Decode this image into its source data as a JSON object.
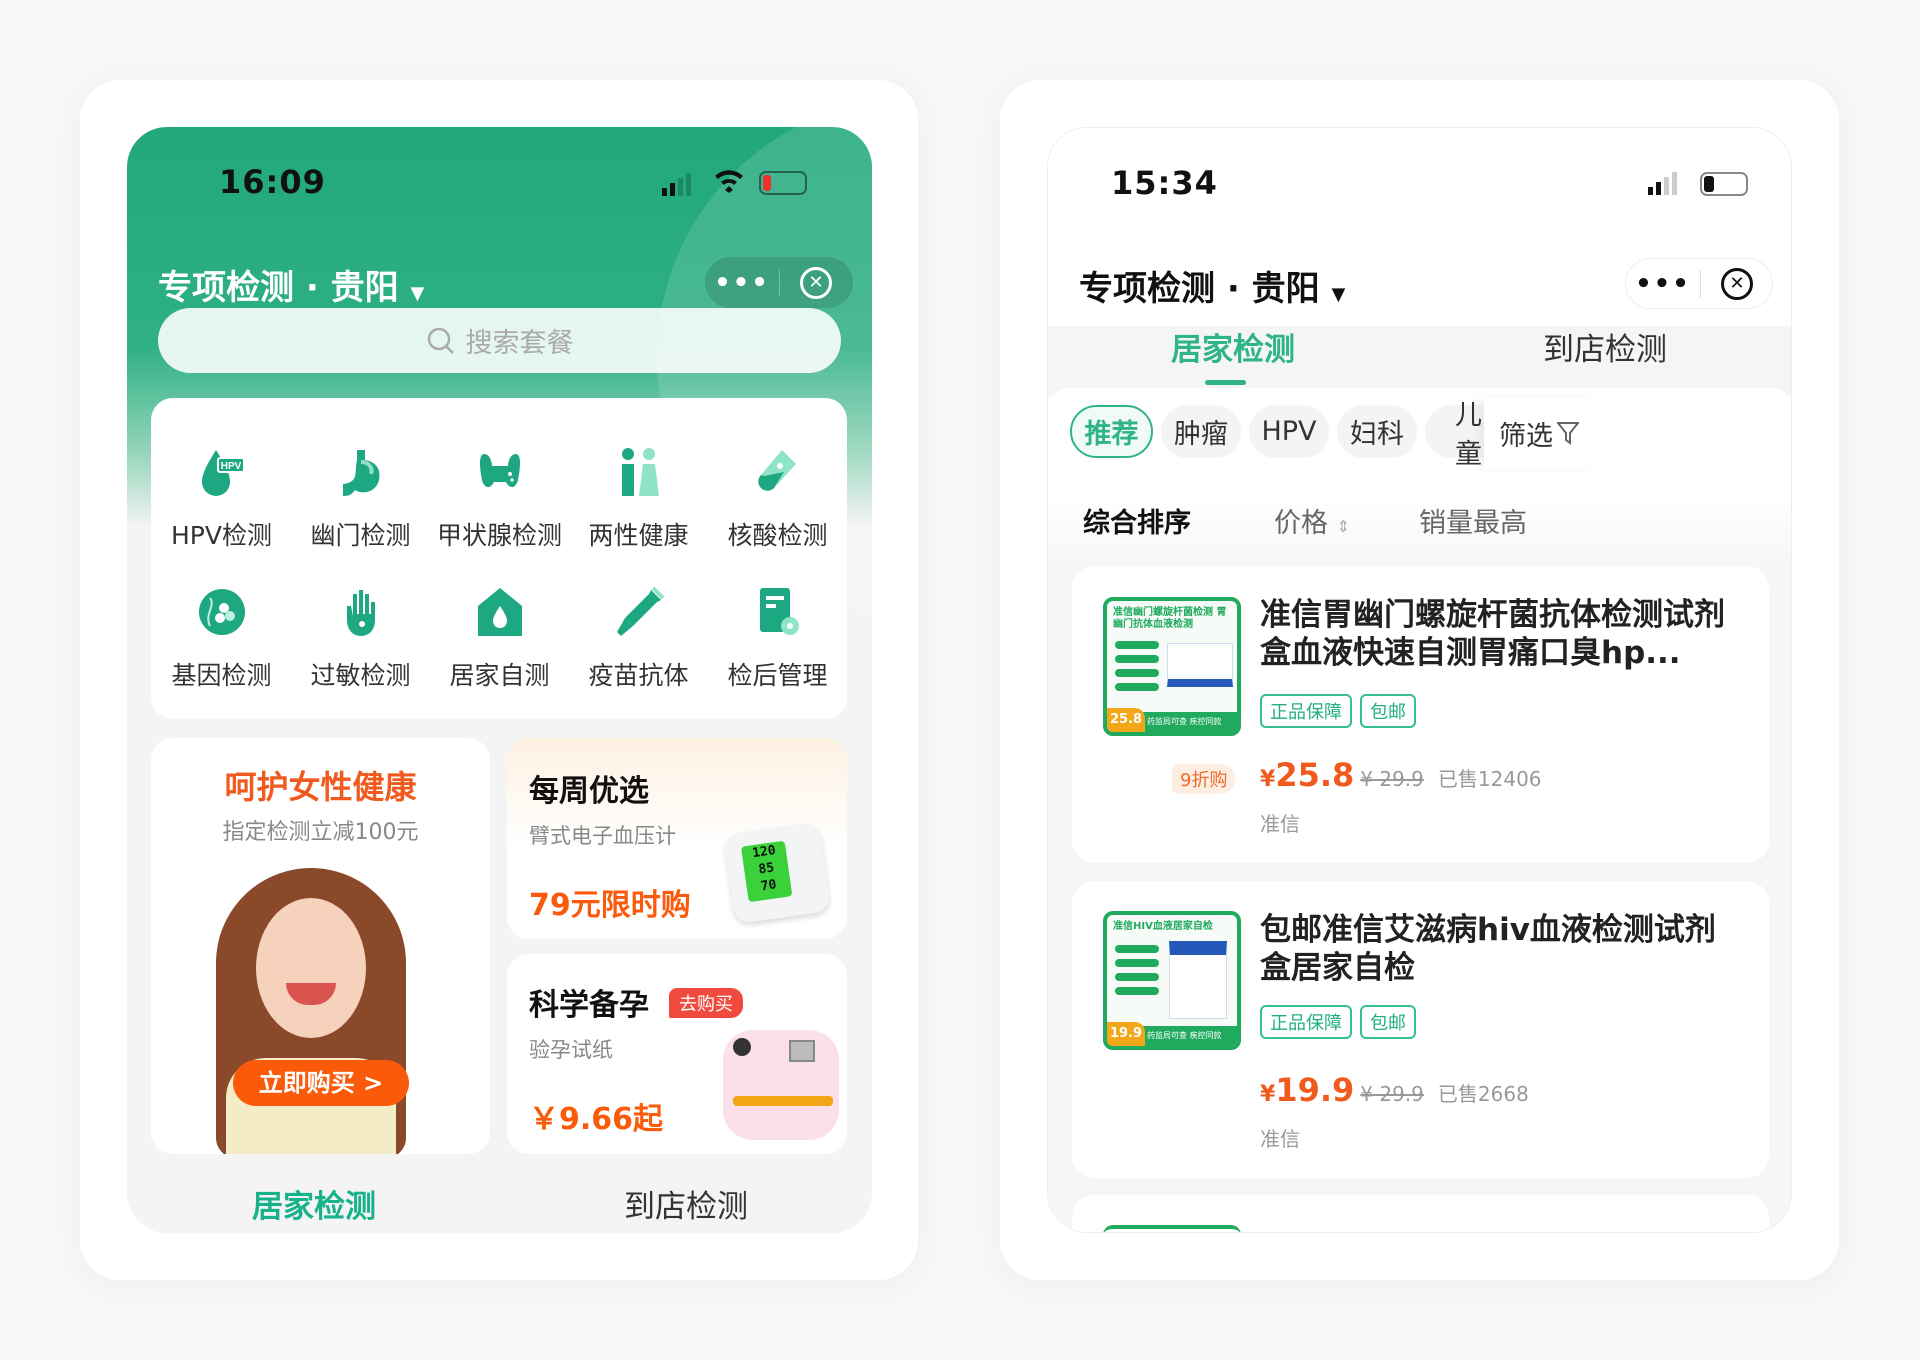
{
  "colors": {
    "brand_green": "#1fae87",
    "accent_orange": "#f05a1e",
    "tag_red": "#f04a3e"
  },
  "left": {
    "status": {
      "time": "16:09"
    },
    "nav": {
      "title": "专项检测 · 贵阳",
      "dropdown_icon": "caret-down",
      "more_label": "•••",
      "close_icon": "close-circle"
    },
    "search": {
      "placeholder": "搜索套餐",
      "icon": "search-icon"
    },
    "categories": [
      {
        "label": "HPV检测",
        "icon": "hpv-drop",
        "badge": "HPV"
      },
      {
        "label": "幽门检测",
        "icon": "stomach"
      },
      {
        "label": "甲状腺检测",
        "icon": "thyroid"
      },
      {
        "label": "两性健康",
        "icon": "gender"
      },
      {
        "label": "核酸检测",
        "icon": "test-tube"
      },
      {
        "label": "基因检测",
        "icon": "dna"
      },
      {
        "label": "过敏检测",
        "icon": "hand"
      },
      {
        "label": "居家自测",
        "icon": "home-drop"
      },
      {
        "label": "疫苗抗体",
        "icon": "syringe"
      },
      {
        "label": "检后管理",
        "icon": "report-gear"
      }
    ],
    "banner_women": {
      "title": "呵护女性健康",
      "subtitle": "指定检测立减100元",
      "button": "立即购买 >"
    },
    "banner_weekly": {
      "title": "每周优选",
      "subtitle": "臂式电子血压计",
      "price": "79元限时购",
      "device_readings": [
        "120",
        "85",
        "70"
      ]
    },
    "banner_pregnancy": {
      "title": "科学备孕",
      "badge": "去购买",
      "subtitle": "验孕试纸",
      "price": "￥9.66起"
    },
    "tabs": [
      {
        "label": "居家检测",
        "active": true
      },
      {
        "label": "到店检测",
        "active": false
      }
    ]
  },
  "right": {
    "status": {
      "time": "15:34"
    },
    "nav": {
      "title": "专项检测 · 贵阳",
      "more_label": "•••"
    },
    "tabs": [
      {
        "label": "居家检测",
        "active": true
      },
      {
        "label": "到店检测",
        "active": false
      }
    ],
    "chips": [
      {
        "label": "推荐",
        "active": true
      },
      {
        "label": "肿瘤"
      },
      {
        "label": "HPV"
      },
      {
        "label": "妇科"
      },
      {
        "label": "儿童"
      }
    ],
    "filter_label": "筛选",
    "sort": [
      {
        "label": "综合排序",
        "active": true
      },
      {
        "label": "价格"
      },
      {
        "label": "销量最高"
      }
    ],
    "products": [
      {
        "title": "准信胃幽门螺旋杆菌抗体检测试剂盒血液快速自测胃痛口臭hp...",
        "tags": [
          "正品保障",
          "包邮"
        ],
        "discount": "9折购",
        "currency": "¥",
        "price": "25.8",
        "old_price": "¥ 29.9",
        "sold": "已售12406",
        "brand": "准信",
        "img_title": "准信幽门螺旋杆菌检测 胃幽门抗体血液检测",
        "img_price": "25.8",
        "img_footer": "药监局可查 疾控同款"
      },
      {
        "title": "包邮准信艾滋病hiv血液检测试剂盒居家自检",
        "tags": [
          "正品保障",
          "包邮"
        ],
        "currency": "¥",
        "price": "19.9",
        "old_price": "¥ 29.9",
        "sold": "已售2668",
        "brand": "准信",
        "img_title": "准信HIV血液居家自检",
        "img_price": "19.9",
        "img_footer": "药监局可查 疾控同款"
      }
    ]
  }
}
